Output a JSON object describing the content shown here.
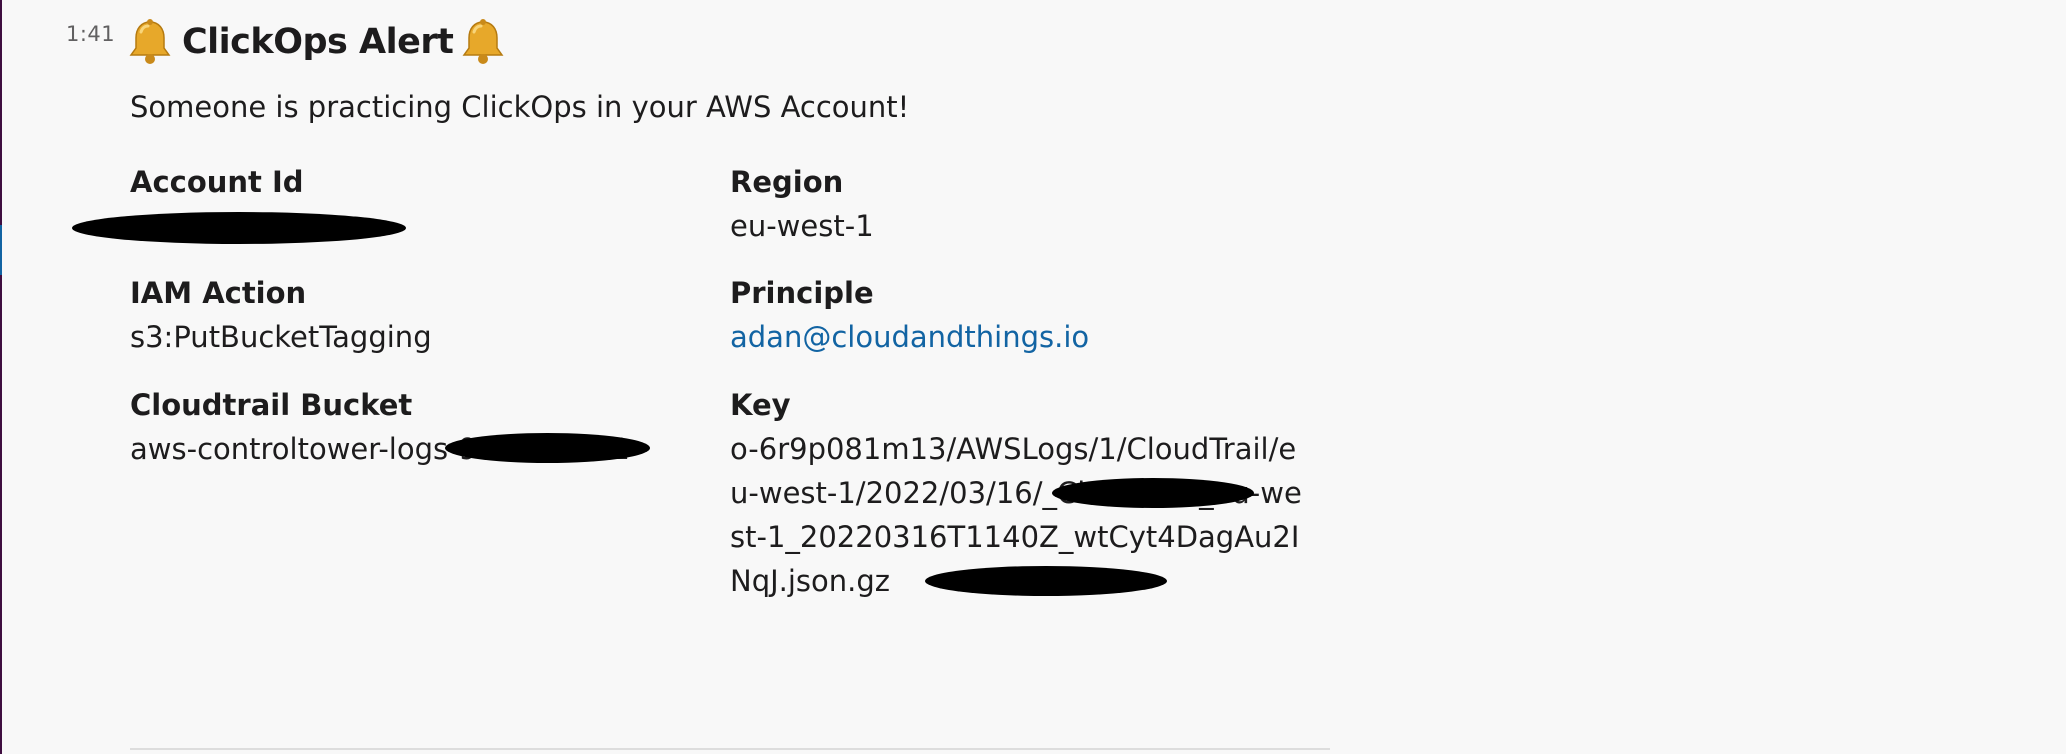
{
  "message": {
    "timestamp": "1:41",
    "title": "ClickOps Alert",
    "intro": "Someone is practicing ClickOps in your AWS Account!",
    "fields": {
      "account_id": {
        "label": "Account Id",
        "value": ""
      },
      "region": {
        "label": "Region",
        "value": "eu-west-1"
      },
      "iam_action": {
        "label": "IAM Action",
        "value": "s3:PutBucketTagging"
      },
      "principle": {
        "label": "Principle",
        "value": "adan@cloudandthings.io"
      },
      "cloudtrail_bucket": {
        "label": "Cloudtrail Bucket",
        "value": "aws-controltower-logs-9 eu-west-1"
      },
      "key": {
        "label": "Key",
        "value": "o-6r9p081m13/AWSLogs/1/CloudTrail/eu-west-1/2022/03/16/_CloudTrail_eu-west-1_20220316T1140Z_wtCyt4DagAu2INqJ.json.gz"
      }
    }
  },
  "icons": {
    "bell": "bell-icon"
  },
  "colors": {
    "background": "#f8f8f8",
    "text": "#1d1c1d",
    "link": "#1264a3",
    "timestamp": "#616061",
    "sidebar_edge": "#3f0e40"
  }
}
